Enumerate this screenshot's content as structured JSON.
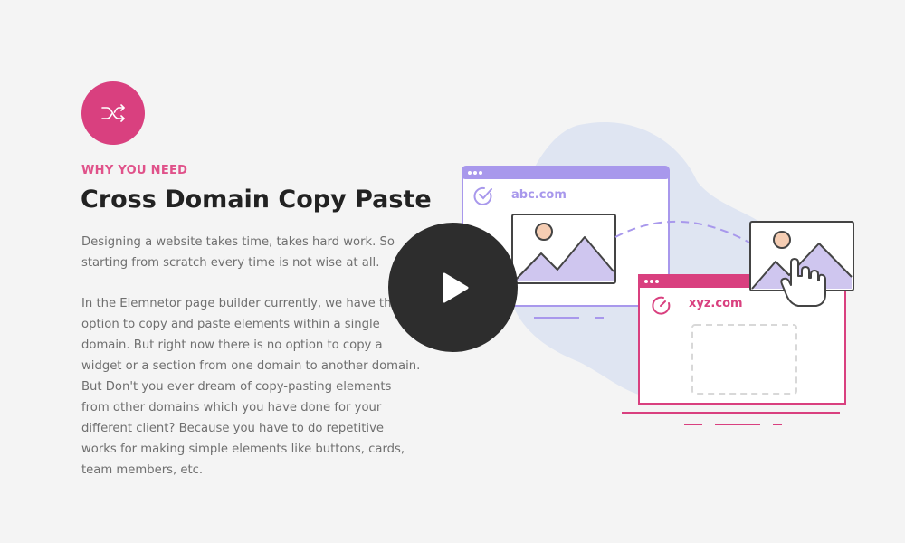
{
  "badge": {
    "icon": "shuffle-icon",
    "color": "#d9407f"
  },
  "eyebrow": "WHY YOU NEED",
  "title": "Cross Domain Copy Paste",
  "paragraphs": [
    "Designing a website takes time, takes hard work. So starting from scratch every time is not wise at all.",
    "In the Elemnetor page builder currently, we have the option to copy and paste elements within a single domain. But right now there is no option to copy a widget or a section from one domain to another domain. But Don't you ever dream of copy-pasting elements from other domains which you have done for your different client? Because you have to do repetitive works for making simple elements like buttons, cards, team members, etc."
  ],
  "illustration": {
    "source_window": {
      "domain": "abc.com",
      "color": "#a898ec"
    },
    "target_window": {
      "domain": "xyz.com",
      "color": "#d9407f"
    }
  },
  "play_button": {
    "icon": "play-icon"
  }
}
